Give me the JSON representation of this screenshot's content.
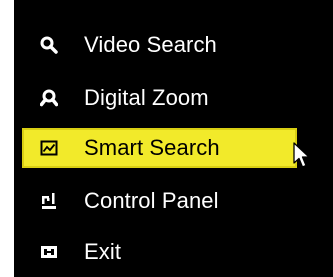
{
  "menu": {
    "items": [
      {
        "label": "Video Search",
        "icon": "search-icon",
        "selected": false
      },
      {
        "label": "Digital Zoom",
        "icon": "zoom-icon",
        "selected": false
      },
      {
        "label": "Smart Search",
        "icon": "chart-image-icon",
        "selected": true
      },
      {
        "label": "Control Panel",
        "icon": "control-panel-icon",
        "selected": false
      },
      {
        "label": "Exit",
        "icon": "exit-icon",
        "selected": false
      }
    ]
  },
  "colors": {
    "background": "#000000",
    "text": "#ffffff",
    "highlight": "#f2ea2a",
    "highlight_text": "#000000"
  }
}
